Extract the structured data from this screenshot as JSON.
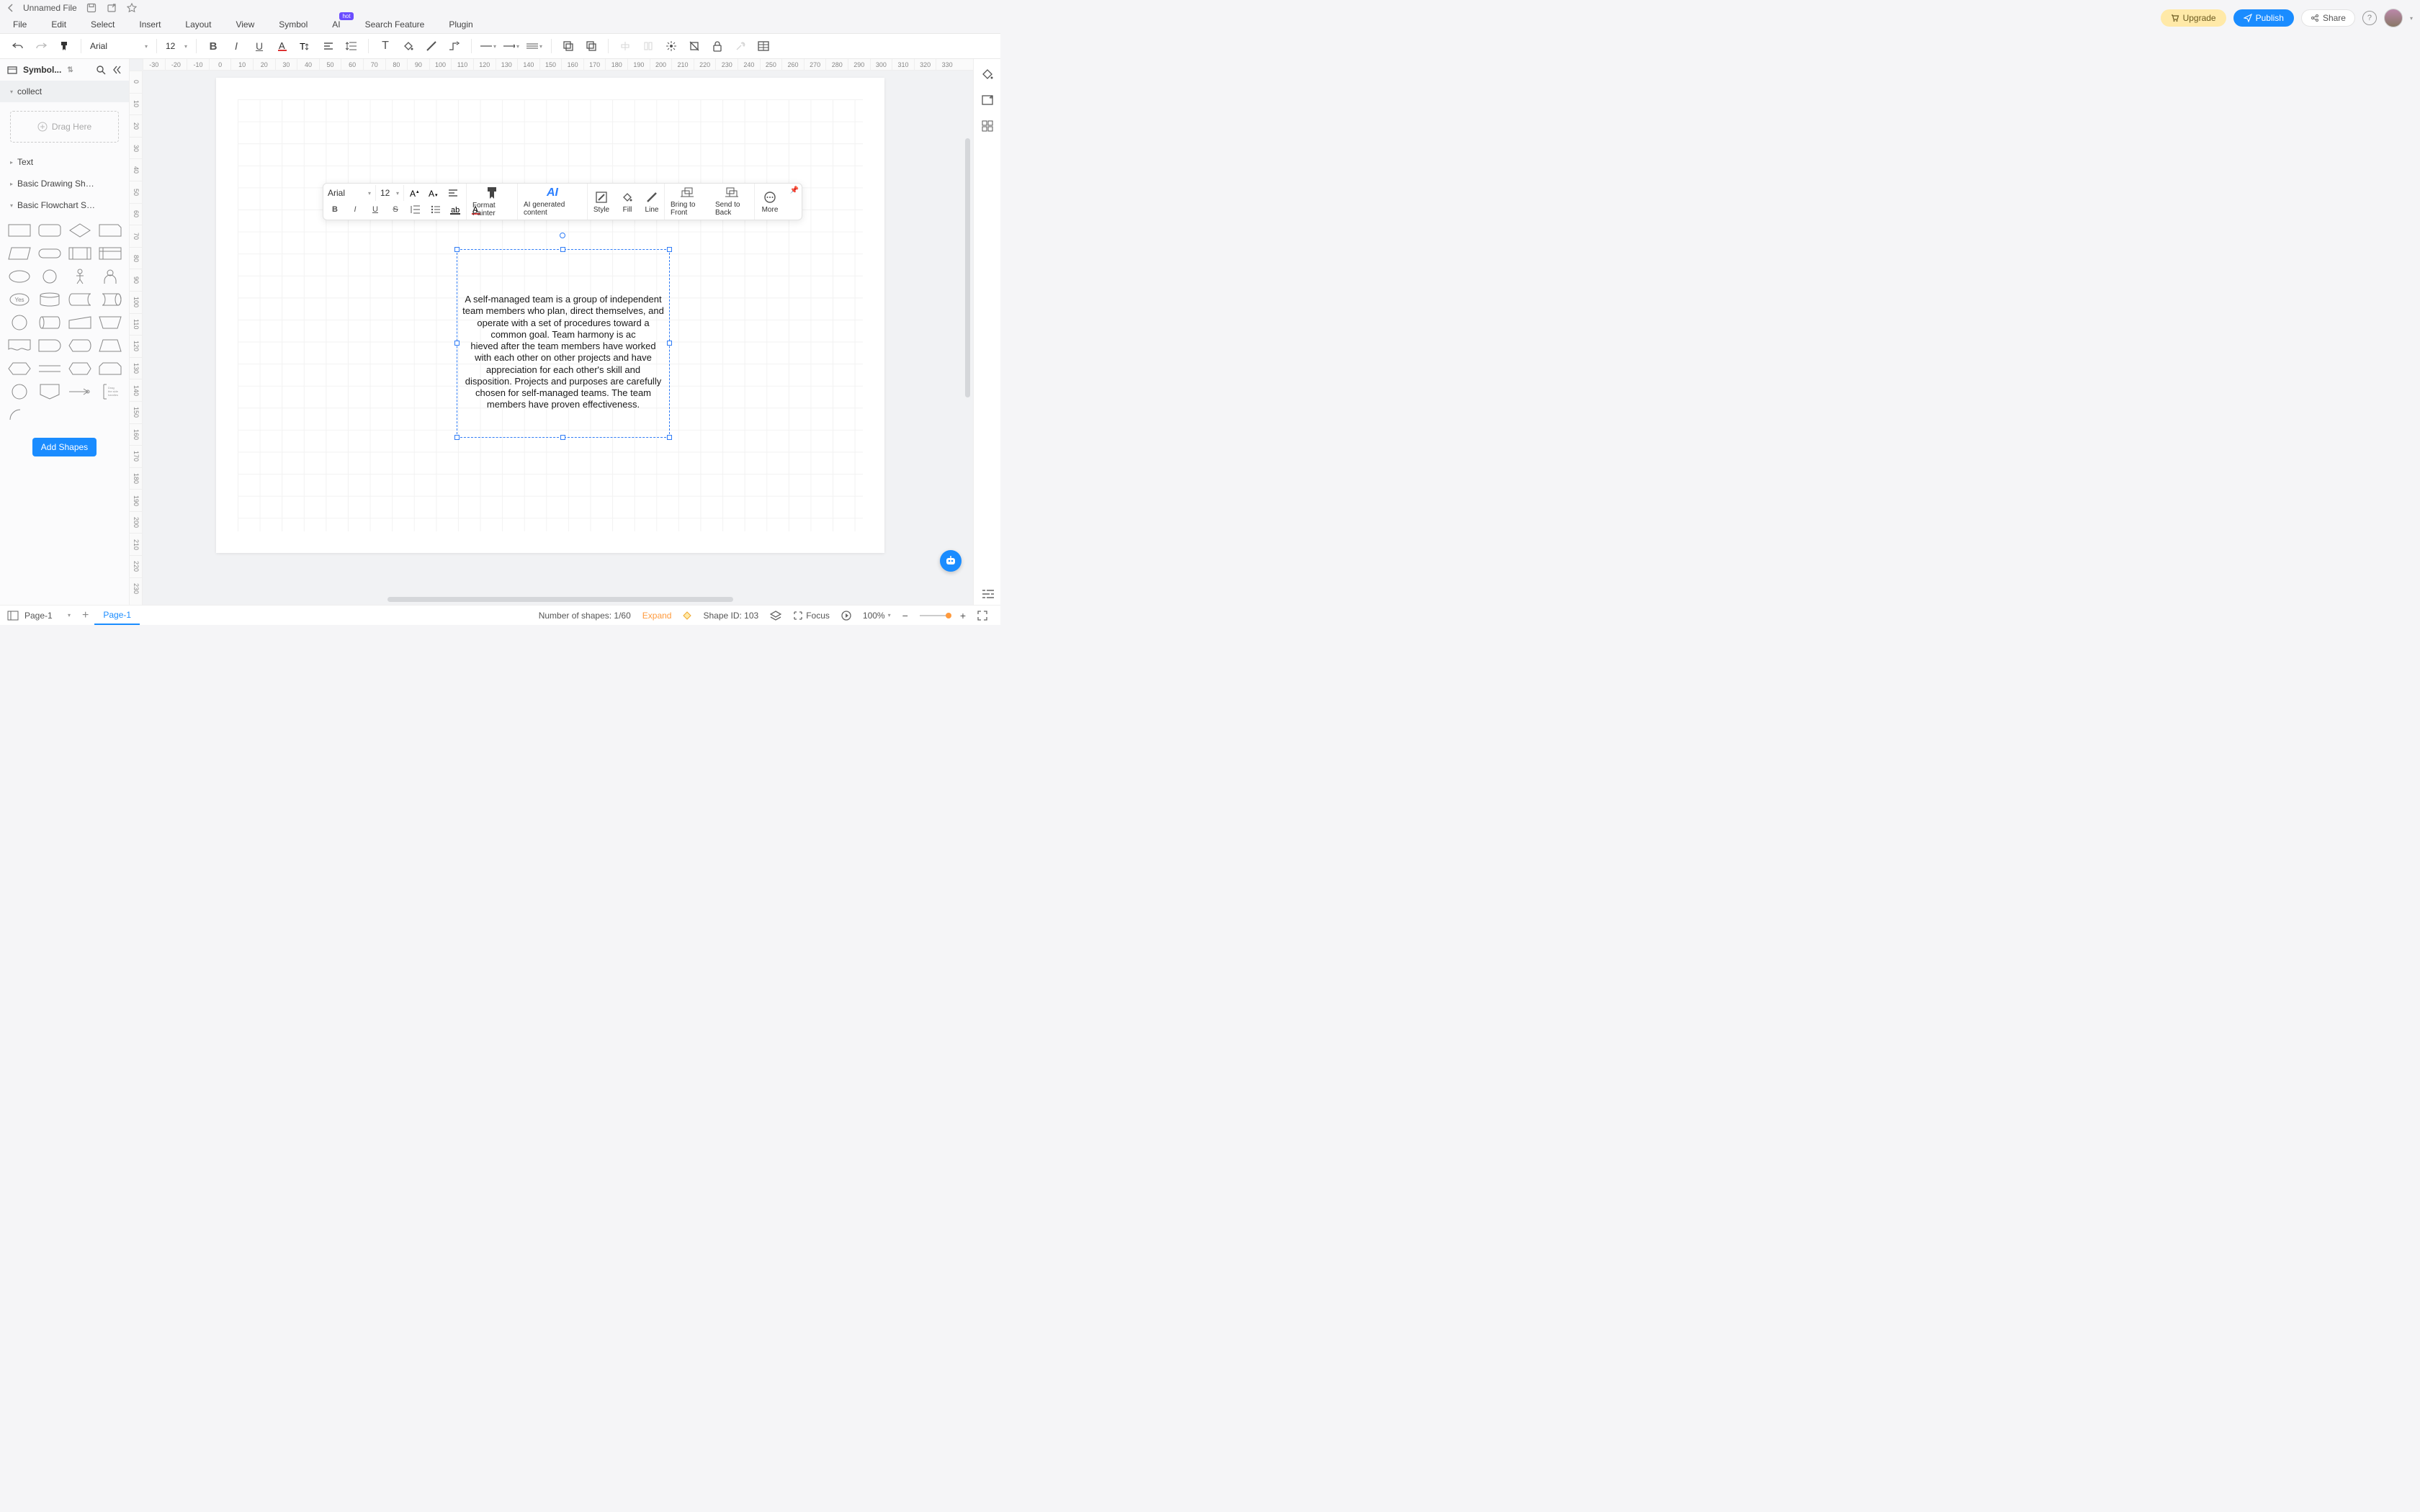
{
  "title": {
    "filename": "Unnamed File"
  },
  "menu": {
    "file": "File",
    "edit": "Edit",
    "select": "Select",
    "insert": "Insert",
    "layout": "Layout",
    "view": "View",
    "symbol": "Symbol",
    "ai": "AI",
    "hot_badge": "hot",
    "search": "Search Feature",
    "plugin": "Plugin"
  },
  "topright": {
    "upgrade": "Upgrade",
    "publish": "Publish",
    "share": "Share"
  },
  "toolbar": {
    "font": "Arial",
    "size": "12"
  },
  "leftpanel": {
    "title": "Symbol...",
    "collect": "collect",
    "drag_here": "Drag Here",
    "section_text": "Text",
    "section_basic_drawing": "Basic Drawing Sh…",
    "section_basic_flowchart": "Basic Flowchart S…",
    "add_shapes": "Add Shapes",
    "yes_label": "Yes"
  },
  "ruler_h": [
    "-30",
    "-20",
    "-10",
    "0",
    "10",
    "20",
    "30",
    "40",
    "50",
    "60",
    "70",
    "80",
    "90",
    "100",
    "110",
    "120",
    "130",
    "140",
    "150",
    "160",
    "170",
    "180",
    "190",
    "200",
    "210",
    "220",
    "230",
    "240",
    "250",
    "260",
    "270",
    "280",
    "290",
    "300",
    "310",
    "320",
    "330"
  ],
  "ruler_v": [
    "0",
    "10",
    "20",
    "30",
    "40",
    "50",
    "60",
    "70",
    "80",
    "90",
    "100",
    "110",
    "120",
    "130",
    "140",
    "150",
    "160",
    "170",
    "180",
    "190",
    "200",
    "210",
    "220",
    "230"
  ],
  "context": {
    "font": "Arial",
    "size": "12",
    "format_painter": "Format Painter",
    "ai": "AI generated content",
    "style": "Style",
    "fill": "Fill",
    "line": "Line",
    "bring_front": "Bring to Front",
    "send_back": "Send to Back",
    "more": "More"
  },
  "canvas": {
    "text_block": "A self-managed team is a group of independent team members who plan, direct themselves, and operate with a set of procedures toward a common goal. Team harmony is ac\nhieved after the team members have worked with each other on other projects and have appreciation for each other's skill and disposition. Projects and purposes are carefully chosen for self-managed teams. The team members have proven effectiveness."
  },
  "bottom": {
    "page_select": "Page-1",
    "page_tab": "Page-1",
    "shapes_count": "Number of shapes: 1/60",
    "expand": "Expand",
    "shape_id": "Shape ID: 103",
    "focus": "Focus",
    "zoom": "100%"
  }
}
